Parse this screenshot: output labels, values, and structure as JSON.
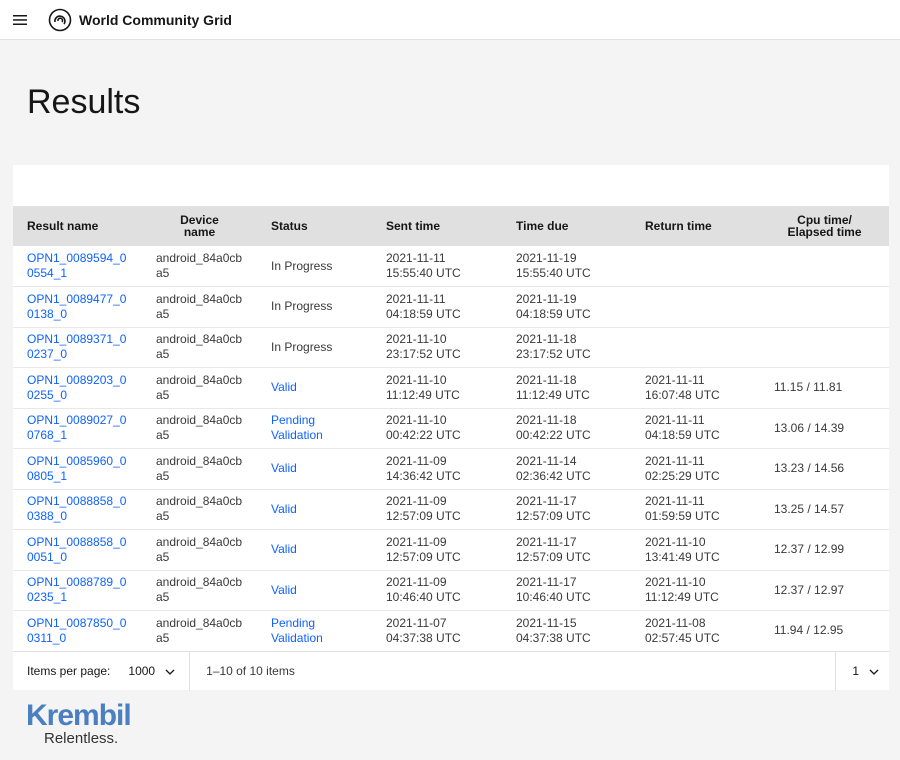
{
  "header": {
    "brand": "World Community Grid",
    "menu_icon": "hamburger-icon",
    "logo_icon": "wcg-logo-icon"
  },
  "page": {
    "title": "Results"
  },
  "table": {
    "columns": [
      {
        "label": "Result name"
      },
      {
        "label": "Device name"
      },
      {
        "label": "Status"
      },
      {
        "label": "Sent time"
      },
      {
        "label": "Time due"
      },
      {
        "label": "Return time"
      },
      {
        "label": "Cpu time/ Elapsed time"
      }
    ],
    "rows": [
      {
        "name": "OPN1_0089594_00554_1",
        "device": "android_84a0cba5",
        "status": "In Progress",
        "status_link": false,
        "sent_date": "2021-11-11",
        "sent_time": "15:55:40 UTC",
        "due_date": "2021-11-19",
        "due_time": "15:55:40 UTC",
        "ret_date": "",
        "ret_time": "",
        "cpu": ""
      },
      {
        "name": "OPN1_0089477_00138_0",
        "device": "android_84a0cba5",
        "status": "In Progress",
        "status_link": false,
        "sent_date": "2021-11-11",
        "sent_time": "04:18:59 UTC",
        "due_date": "2021-11-19",
        "due_time": "04:18:59 UTC",
        "ret_date": "",
        "ret_time": "",
        "cpu": ""
      },
      {
        "name": "OPN1_0089371_00237_0",
        "device": "android_84a0cba5",
        "status": "In Progress",
        "status_link": false,
        "sent_date": "2021-11-10",
        "sent_time": "23:17:52 UTC",
        "due_date": "2021-11-18",
        "due_time": "23:17:52 UTC",
        "ret_date": "",
        "ret_time": "",
        "cpu": ""
      },
      {
        "name": "OPN1_0089203_00255_0",
        "device": "android_84a0cba5",
        "status": "Valid",
        "status_link": true,
        "sent_date": "2021-11-10",
        "sent_time": "11:12:49 UTC",
        "due_date": "2021-11-18",
        "due_time": "11:12:49 UTC",
        "ret_date": "2021-11-11",
        "ret_time": "16:07:48 UTC",
        "cpu": "11.15 / 11.81"
      },
      {
        "name": "OPN1_0089027_00768_1",
        "device": "android_84a0cba5",
        "status": "Pending Validation",
        "status_link": true,
        "sent_date": "2021-11-10",
        "sent_time": "00:42:22 UTC",
        "due_date": "2021-11-18",
        "due_time": "00:42:22 UTC",
        "ret_date": "2021-11-11",
        "ret_time": "04:18:59 UTC",
        "cpu": "13.06 / 14.39"
      },
      {
        "name": "OPN1_0085960_00805_1",
        "device": "android_84a0cba5",
        "status": "Valid",
        "status_link": true,
        "sent_date": "2021-11-09",
        "sent_time": "14:36:42 UTC",
        "due_date": "2021-11-14",
        "due_time": "02:36:42 UTC",
        "ret_date": "2021-11-11",
        "ret_time": "02:25:29 UTC",
        "cpu": "13.23 / 14.56"
      },
      {
        "name": "OPN1_0088858_00388_0",
        "device": "android_84a0cba5",
        "status": "Valid",
        "status_link": true,
        "sent_date": "2021-11-09",
        "sent_time": "12:57:09 UTC",
        "due_date": "2021-11-17",
        "due_time": "12:57:09 UTC",
        "ret_date": "2021-11-11",
        "ret_time": "01:59:59 UTC",
        "cpu": "13.25 / 14.57"
      },
      {
        "name": "OPN1_0088858_00051_0",
        "device": "android_84a0cba5",
        "status": "Valid",
        "status_link": true,
        "sent_date": "2021-11-09",
        "sent_time": "12:57:09 UTC",
        "due_date": "2021-11-17",
        "due_time": "12:57:09 UTC",
        "ret_date": "2021-11-10",
        "ret_time": "13:41:49 UTC",
        "cpu": "12.37 / 12.99"
      },
      {
        "name": "OPN1_0088789_00235_1",
        "device": "android_84a0cba5",
        "status": "Valid",
        "status_link": true,
        "sent_date": "2021-11-09",
        "sent_time": "10:46:40 UTC",
        "due_date": "2021-11-17",
        "due_time": "10:46:40 UTC",
        "ret_date": "2021-11-10",
        "ret_time": "11:12:49 UTC",
        "cpu": "12.37 / 12.97"
      },
      {
        "name": "OPN1_0087850_00311_0",
        "device": "android_84a0cba5",
        "status": "Pending Validation",
        "status_link": true,
        "sent_date": "2021-11-07",
        "sent_time": "04:37:38 UTC",
        "due_date": "2021-11-15",
        "due_time": "04:37:38 UTC",
        "ret_date": "2021-11-08",
        "ret_time": "02:57:45 UTC",
        "cpu": "11.94 / 12.95"
      }
    ]
  },
  "pagination": {
    "items_per_page_label": "Items per page:",
    "items_per_page_value": "1000",
    "range_text": "1–10 of 10 items",
    "page_value": "1",
    "chevron_icon": "chevron-down-icon"
  },
  "footer": {
    "logo_word": "Krembil",
    "tagline": "Relentless."
  },
  "colors": {
    "link": "#0f62fe",
    "header_bg": "#e0e0e0",
    "page_bg": "#f4f4f4",
    "krembil_blue": "#4a7fc1"
  }
}
